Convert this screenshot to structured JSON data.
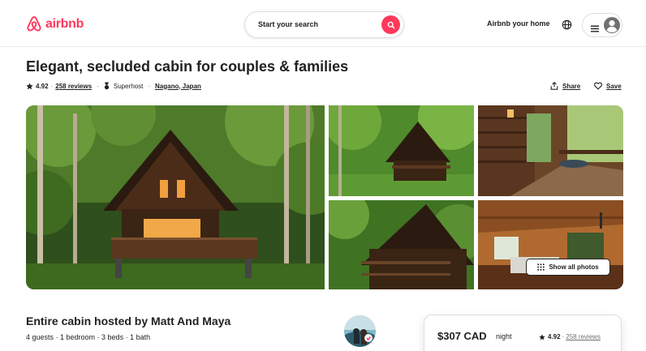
{
  "header": {
    "logo_text": "airbnb",
    "search_placeholder": "Start your search",
    "host_link": "Airbnb your home",
    "icons": [
      "airbnb-logo-icon",
      "search-icon",
      "globe-icon",
      "hamburger-icon",
      "user-avatar-icon"
    ]
  },
  "listing": {
    "title": "Elegant, secluded cabin for couples & families",
    "rating": "4.92",
    "reviews": "258 reviews",
    "badge": "Superhost",
    "location": "Nagano, Japan",
    "share_label": "Share",
    "save_label": "Save"
  },
  "gallery": {
    "show_all_label": "Show all photos"
  },
  "details": {
    "host_title": "Entire cabin hosted by Matt And Maya",
    "summary": "4 guests · 1 bedroom · 3 beds · 1 bath"
  },
  "booking": {
    "price": "$307 CAD",
    "per": "night",
    "rating": "4.92",
    "reviews": "258 reviews"
  },
  "colors": {
    "brand": "#FF385C",
    "text": "#222222",
    "muted": "#717171",
    "border": "#DDDDDD"
  }
}
